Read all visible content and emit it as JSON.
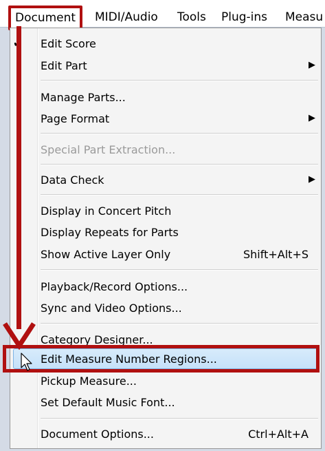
{
  "menubar": {
    "items": [
      {
        "label": "Document",
        "active": true
      },
      {
        "label": "MIDI/Audio"
      },
      {
        "label": "Tools"
      },
      {
        "label": "Plug-ins"
      },
      {
        "label": "Measu"
      }
    ]
  },
  "menu": {
    "items": {
      "edit_score": {
        "label": "Edit Score",
        "checked": true
      },
      "edit_part": {
        "label": "Edit Part",
        "submenu": true
      },
      "manage_parts": {
        "label": "Manage Parts..."
      },
      "page_format": {
        "label": "Page Format",
        "submenu": true
      },
      "special_part_extraction": {
        "label": "Special Part Extraction...",
        "disabled": true
      },
      "data_check": {
        "label": "Data Check",
        "submenu": true
      },
      "display_concert_pitch": {
        "label": "Display in Concert Pitch"
      },
      "display_repeats": {
        "label": "Display Repeats for Parts"
      },
      "show_active_layer": {
        "label": "Show Active Layer Only",
        "shortcut": "Shift+Alt+S"
      },
      "playback_record": {
        "label": "Playback/Record Options..."
      },
      "sync_video": {
        "label": "Sync and Video Options..."
      },
      "category_designer": {
        "label": "Category Designer..."
      },
      "edit_measure_number_regions": {
        "label": "Edit Measure Number Regions...",
        "highlighted": true
      },
      "pickup_measure": {
        "label": "Pickup Measure..."
      },
      "set_default_music_font": {
        "label": "Set Default Music Font..."
      },
      "document_options": {
        "label": "Document Options...",
        "shortcut": "Ctrl+Alt+A"
      }
    }
  },
  "icons": {
    "checkmark": "checkmark-icon",
    "submenu_arrow": "submenu-arrow-icon",
    "cursor": "mouse-pointer-icon",
    "annotation_arrow": "annotation-arrow-icon"
  },
  "colors": {
    "annotation_red": "#b01010",
    "highlight_border": "#7db4e6",
    "disabled_text": "#9a9a9a"
  }
}
